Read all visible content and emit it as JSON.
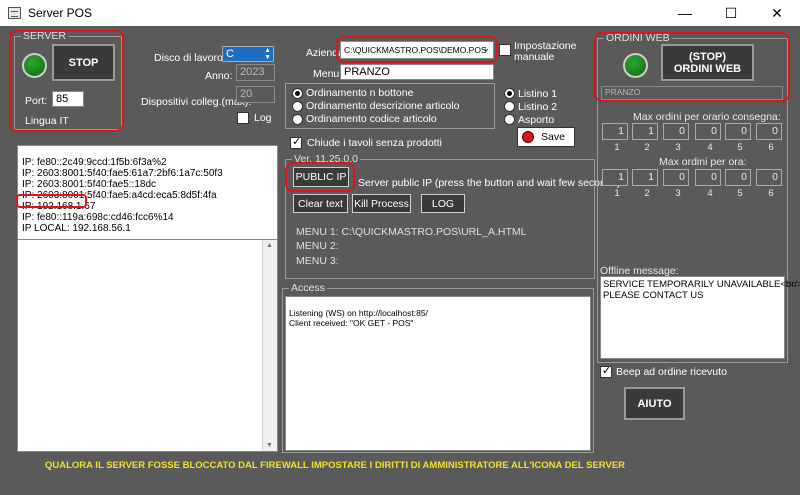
{
  "window": {
    "title": "Server POS"
  },
  "server": {
    "group_title": "SERVER",
    "stop_label": "STOP",
    "port_label": "Port:",
    "port_value": "85",
    "language": "Lingua IT"
  },
  "settings": {
    "disco_label": "Disco di lavoro:",
    "disco_value": "C",
    "anno_label": "Anno:",
    "anno_value": "2023",
    "dispositivi_label": "Dispositivi colleg.(max):",
    "dispositivi_value": "20",
    "log_label": "Log"
  },
  "ip_list": [
    "IP: fe80::2c49:9ccd:1f5b:6f3a%2",
    "IP: 2603:8001:5f40:fae5:61a7:2bf6:1a7c:50f3",
    "IP: 2603:8001:5f40:fae5::18dc",
    "IP: 2603:8001:5f40:fae5:a4cd:eca5:8d5f:4fa",
    "IP: 192.168.1.67",
    "IP: fe80::119a:698c:cd46:fcc6%14",
    "IP LOCAL: 192.168.56.1"
  ],
  "azienda": {
    "label": "Azienda",
    "value": "C:\\QUICKMASTRO.POS\\DEMO.POS",
    "menu_label": "Menu",
    "menu_value": "PRANZO",
    "manual_label": "Impostazione manuale"
  },
  "ordering": {
    "options": [
      "Ordinamento n bottone",
      "Ordinamento descrizione articolo",
      "Ordinamento codice articolo"
    ],
    "selected": 0,
    "close_tables_label": "Chiude i tavoli senza prodotti"
  },
  "listino": {
    "options": [
      "Listino 1",
      "Listino 2",
      "Asporto"
    ],
    "selected": 0,
    "save_label": "Save"
  },
  "ver": {
    "group_title": "Ver. 11.25.0.0",
    "public_ip_label": "PUBLIC IP",
    "public_ip_hint": "Server public IP (press the button and wait few seconds)",
    "clear_label": "Clear text",
    "kill_label": "Kill Process",
    "log_label": "LOG",
    "menu_lines": [
      "MENU 1: C:\\QUICKMASTRO.POS\\URL_A.HTML",
      "MENU 2:",
      "MENU 3:"
    ]
  },
  "access": {
    "group_title": "Access",
    "lines": [
      "Listening (WS) on http://localhost:85/",
      "Client received: \"OK GET - POS\""
    ]
  },
  "web_orders": {
    "group_title": "ORDINI WEB",
    "button_line1": "(STOP)",
    "button_line2": "ORDINI WEB",
    "menu_value": "PRANZO",
    "max_delivery_label": "Max ordini per orario consegna:",
    "max_delivery_values": [
      "1",
      "1",
      "0",
      "0",
      "0",
      "0"
    ],
    "max_hour_label": "Max ordini per ora:",
    "max_hour_values": [
      "1",
      "1",
      "0",
      "0",
      "0",
      "0"
    ],
    "slot_numbers": [
      "1",
      "2",
      "3",
      "4",
      "5",
      "6"
    ],
    "offline_label": "Offline message:",
    "offline_lines": [
      "SERVICE TEMPORARILY UNAVAILABLE<br/>",
      "PLEASE CONTACT US"
    ],
    "beep_label": "Beep ad ordine ricevuto"
  },
  "aiuto_label": "AIUTO",
  "footer_warning": "QUALORA IL SERVER FOSSE BLOCCATO DAL FIREWALL IMPOSTARE I DIRITTI DI AMMINISTRATORE ALL'ICONA DEL SERVER"
}
